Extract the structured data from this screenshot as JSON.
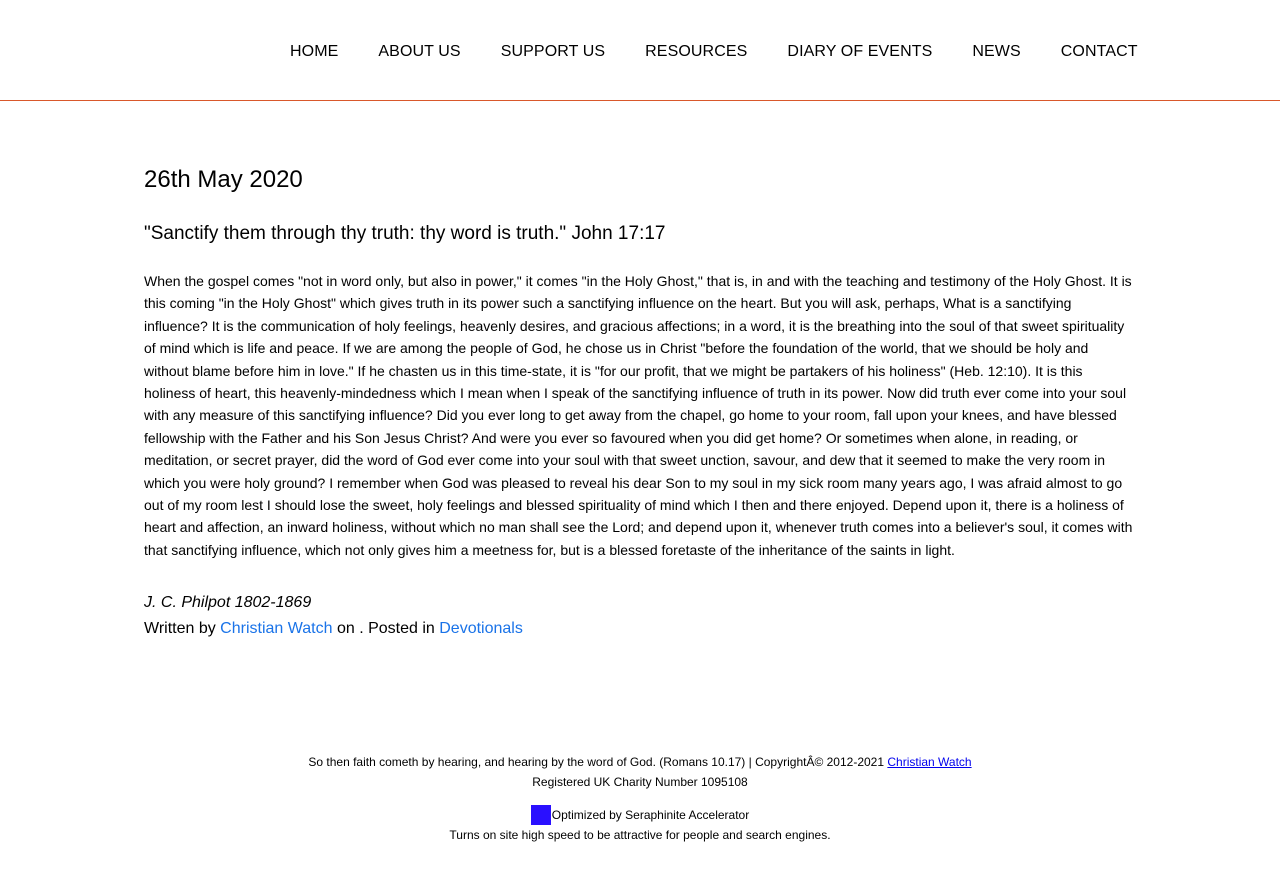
{
  "nav": {
    "items": [
      {
        "label": "HOME"
      },
      {
        "label": "ABOUT US"
      },
      {
        "label": "SUPPORT US"
      },
      {
        "label": "RESOURCES"
      },
      {
        "label": "DIARY OF EVENTS"
      },
      {
        "label": "NEWS"
      },
      {
        "label": "CONTACT"
      }
    ]
  },
  "post": {
    "date": "26th May 2020",
    "quote": "\"Sanctify them through thy truth: thy word is truth.\" John 17:17",
    "body": "When the gospel comes \"not in word only, but also in power,\" it comes \"in the Holy Ghost,\" that is, in and with the teaching and testimony of the Holy Ghost. It is this coming \"in the Holy Ghost\" which gives truth in its power such a sanctifying influence on the heart. But you will ask, perhaps, What is a sanctifying influence? It is the communication of holy feelings, heavenly desires, and gracious affections; in a word, it is the breathing into the soul of that sweet spirituality of mind which is life and peace. If we are among the people of God, he chose us in Christ \"before the foundation of the world, that we should be holy and without blame before him in love.\" If he chasten us in this time-state, it is \"for our profit, that we might be partakers of his holiness\" (Heb. 12:10). It is this holiness of heart, this heavenly-mindedness which I mean when I speak of the sanctifying influence of truth in its power. Now did truth ever come into your soul with any measure of this sanctifying influence? Did you ever long to get away from the chapel, go home to your room, fall upon your knees, and have blessed fellowship with the Father and his Son Jesus Christ? And were you ever so favoured when you did get home? Or sometimes when alone, in reading, or meditation, or secret prayer, did the word of God ever come into your soul with that sweet unction, savour, and dew that it seemed to make the very room in which you were holy ground? I remember when God was pleased to reveal his dear Son to my soul in my sick room many years ago, I was afraid almost to go out of my room lest I should lose the sweet, holy feelings and blessed spirituality of mind which I then and there enjoyed. Depend upon it, there is a holiness of heart and affection, an inward holiness, without which no man shall see the Lord; and depend upon it, whenever truth comes into a believer's soul, it comes with that sanctifying influence, which not only gives him a meetness for, but is a blessed foretaste of the inheritance of the saints in light.",
    "author": "J. C. Philpot 1802-1869",
    "meta": {
      "written_by": "Written by ",
      "author_link": "Christian Watch",
      "on": " on . Posted in ",
      "category_link": "Devotionals"
    }
  },
  "footer": {
    "verse": "So then faith cometh by hearing, and hearing by the word of God. (Romans 10.17) | CopyrightÂ© 2012-2021 ",
    "copyright_link": "Christian Watch",
    "charity": "Registered UK Charity Number 1095108",
    "optimized": "Optimized by Seraphinite Accelerator",
    "optimized_tagline": "Turns on site high speed to be attractive for people and search engines."
  },
  "colors": {
    "header_border": "#d9582b",
    "link": "#1a73e8",
    "footer_link": "#0000ee",
    "optimizer_badge": "#2a10ff"
  }
}
